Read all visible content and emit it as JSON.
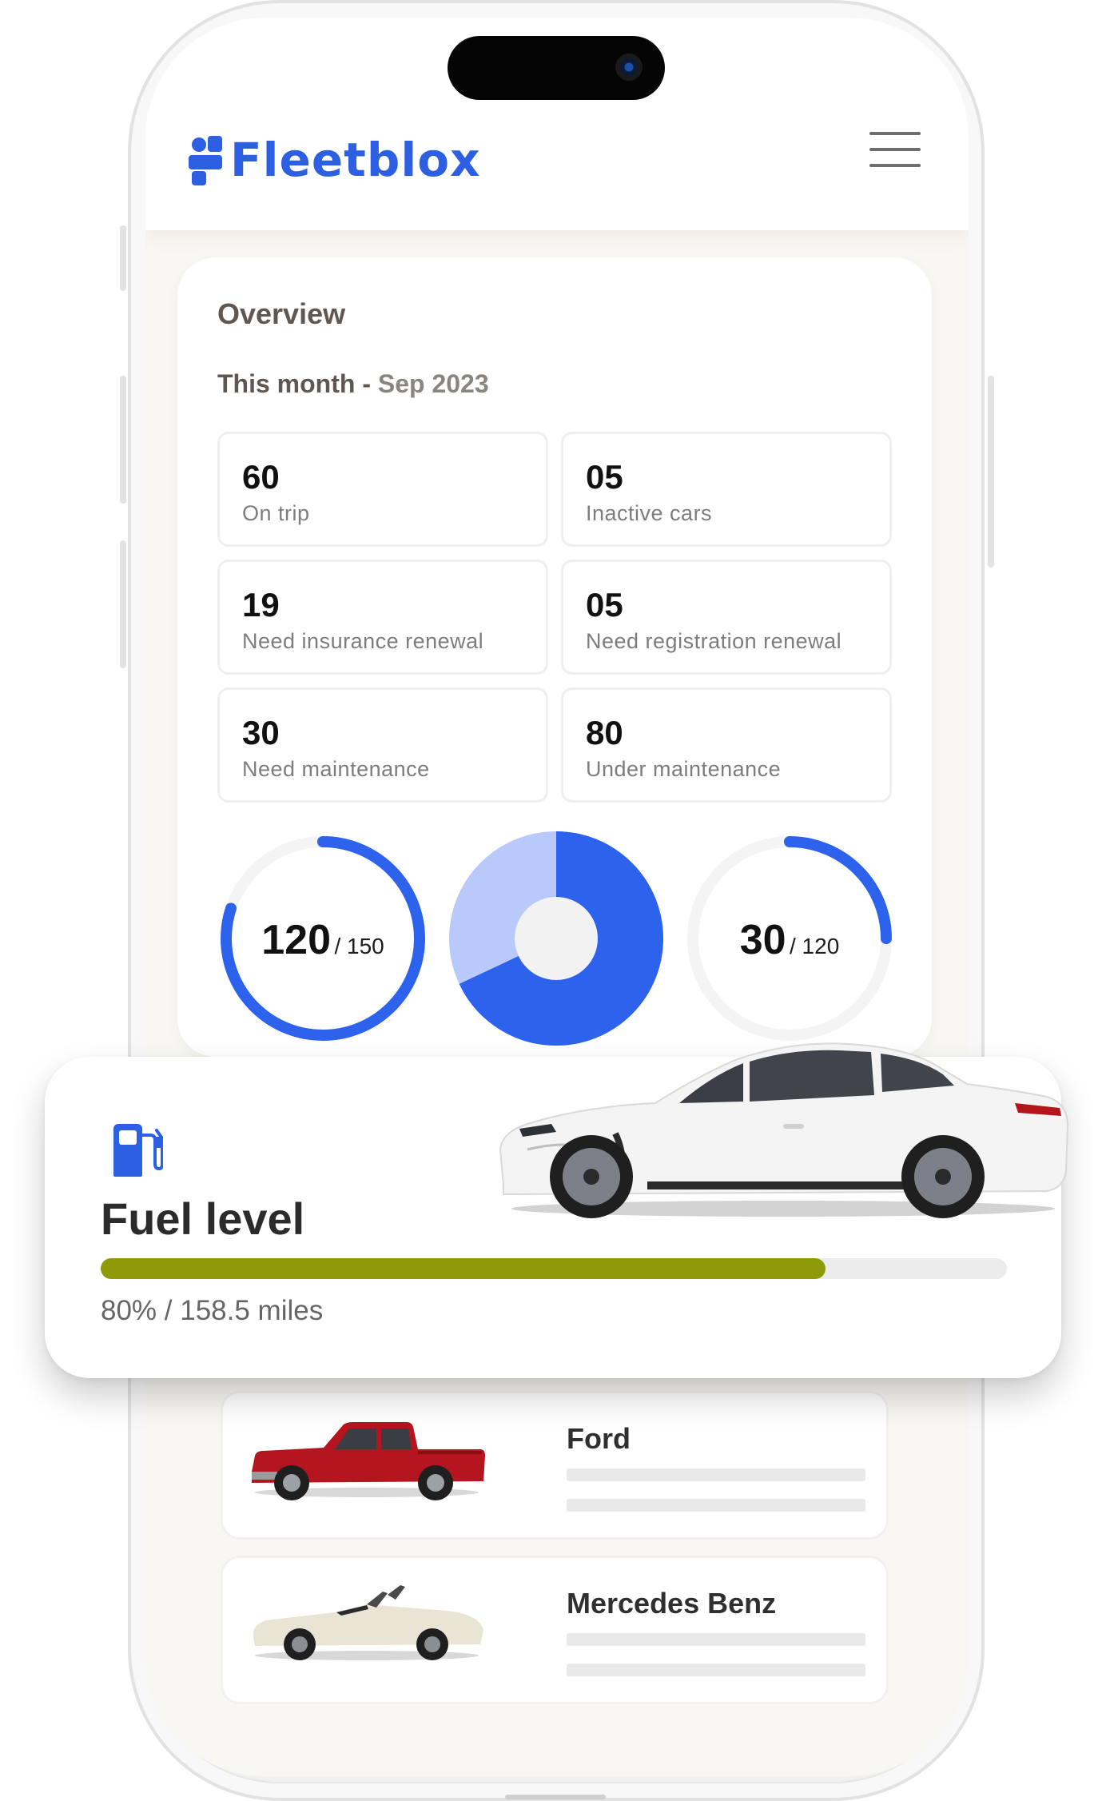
{
  "brand": {
    "name": "Fleetblox",
    "color": "#2d5fe3"
  },
  "header": {
    "menu_icon": "hamburger-menu-icon"
  },
  "overview": {
    "title": "Overview",
    "period_label": "This month",
    "period_sep": " - ",
    "period_value": "Sep 2023",
    "stats": [
      {
        "value": "60",
        "label": "On trip"
      },
      {
        "value": "05",
        "label": "Inactive cars"
      },
      {
        "value": "19",
        "label": "Need insurance renewal"
      },
      {
        "value": "05",
        "label": "Need registration renewal"
      },
      {
        "value": "30",
        "label": "Need maintenance"
      },
      {
        "value": "80",
        "label": "Under maintenance"
      }
    ],
    "gauges": [
      {
        "value": "120",
        "total": "/ 150",
        "fraction": 0.8
      },
      {
        "type": "donut",
        "fraction": 0.68
      },
      {
        "value": "30",
        "total": "/ 120",
        "fraction": 0.25
      }
    ],
    "accent_color": "#2d62ed",
    "accent_light": "#b8c9fa"
  },
  "fuel": {
    "icon": "fuel-pump-icon",
    "title": "Fuel level",
    "percent": 0.8,
    "text": "80% / 158.5 miles",
    "bar_color": "#8e9a0a"
  },
  "vehicles": [
    {
      "name": "Ford",
      "image": "red-pickup-truck"
    },
    {
      "name": "Mercedes Benz",
      "image": "cream-convertible"
    }
  ]
}
